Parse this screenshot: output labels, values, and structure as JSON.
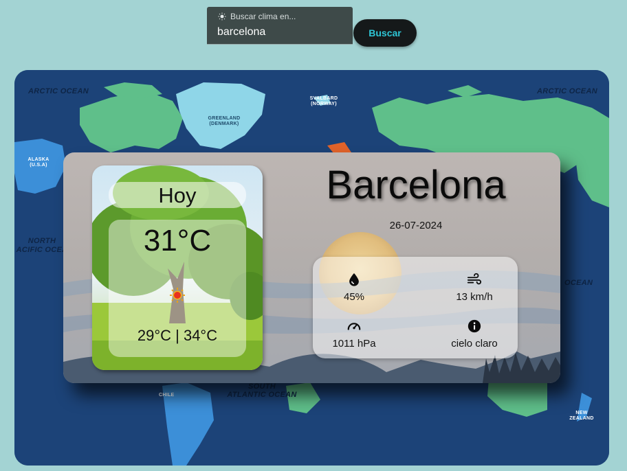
{
  "search": {
    "label": "Buscar clima en...",
    "value": "barcelona",
    "button_label": "Buscar",
    "label_icon": "sun-icon"
  },
  "map": {
    "labels": {
      "arctic_left": "ARCTIC OCEAN",
      "arctic_right": "ARCTIC OCEAN",
      "greenland": "GREENLAND",
      "greenland_sub": "(DENMARK)",
      "svalbard": "SVALBARD",
      "svalbard_sub": "(NORWAY)",
      "alaska": "ALASKA",
      "alaska_sub": "(U.S.A)",
      "north_pacific": "NORTH",
      "north_pacific_sub": "ACIFIC OCEA",
      "indian": "OCEAN",
      "south_atlantic": "SOUTH",
      "south_atlantic_sub": "ATLANTIC OCEAN",
      "new_zealand": "NEW ZEALAND",
      "chile": "CHILE"
    }
  },
  "weather": {
    "today_label": "Hoy",
    "temperature": "31°C",
    "temp_range": "29°C | 34°C",
    "condition_icon": "sun-icon",
    "city": "Barcelona",
    "date": "26-07-2024",
    "humidity": "45%",
    "wind": "13 km/h",
    "pressure": "1011 hPa",
    "description": "cielo claro",
    "icons": {
      "humidity": "water-drop-icon",
      "wind": "wind-icon",
      "pressure": "gauge-icon",
      "description": "info-icon"
    }
  },
  "colors": {
    "page_bg": "#a3d3d3",
    "search_bg": "#3e4a49",
    "button_bg": "#15191a",
    "button_text": "#2ec6d6",
    "ocean": "#1c4378",
    "land": "#5fbf8a"
  }
}
